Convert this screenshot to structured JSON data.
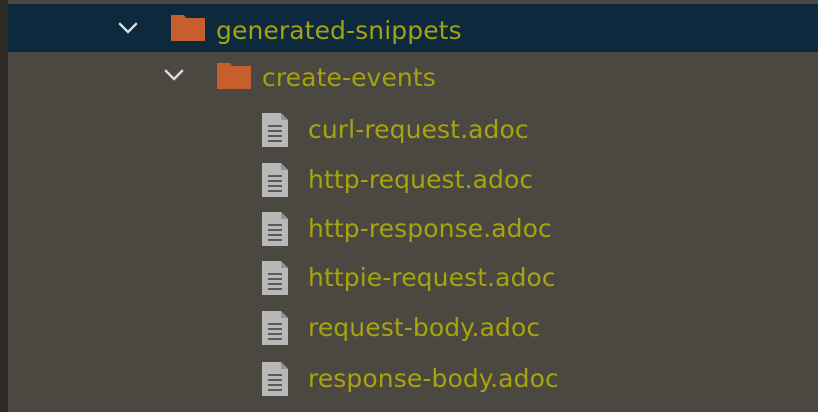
{
  "tree": {
    "folders": [
      {
        "label": "generated-snippets",
        "expanded": true,
        "selected": true,
        "icon": "folder-icon"
      },
      {
        "label": "create-events",
        "expanded": true,
        "selected": false,
        "icon": "folder-icon"
      }
    ],
    "files": [
      {
        "label": "curl-request.adoc",
        "icon": "document-icon"
      },
      {
        "label": "http-request.adoc",
        "icon": "document-icon"
      },
      {
        "label": "http-response.adoc",
        "icon": "document-icon"
      },
      {
        "label": "httpie-request.adoc",
        "icon": "document-icon"
      },
      {
        "label": "request-body.adoc",
        "icon": "document-icon"
      },
      {
        "label": "response-body.adoc",
        "icon": "document-icon"
      }
    ]
  },
  "colors": {
    "background": "#4b4741",
    "selection": "#0d293e",
    "label": "#a7a40d",
    "folder": "#c65f2d",
    "file": "#b8b8b8"
  }
}
